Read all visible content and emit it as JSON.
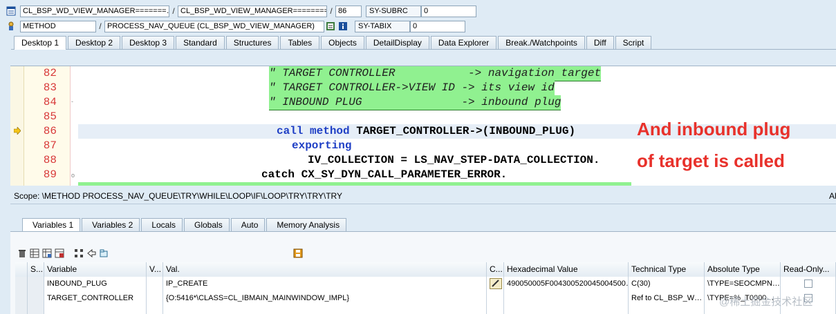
{
  "header": {
    "row1": {
      "class_field": "CL_BSP_WD_VIEW_MANAGER=======…",
      "include_field": "CL_BSP_WD_VIEW_MANAGER========…",
      "line_field": "86",
      "sysvar_label": "SY-SUBRC",
      "sysvar_value": "0"
    },
    "row2": {
      "type_field": "METHOD",
      "method_field": "PROCESS_NAV_QUEUE (CL_BSP_WD_VIEW_MANAGER)",
      "sysvar_label": "SY-TABIX",
      "sysvar_value": "0"
    },
    "separator": "/"
  },
  "tabs": [
    "Desktop 1",
    "Desktop 2",
    "Desktop 3",
    "Standard",
    "Structures",
    "Tables",
    "Objects",
    "DetailDisplay",
    "Data Explorer",
    "Break./Watchpoints",
    "Diff",
    "Script"
  ],
  "code": {
    "lines": [
      {
        "num": "82",
        "text": "\" TARGET CONTROLLER           -> navigation target"
      },
      {
        "num": "83",
        "text": "\" TARGET CONTROLLER->VIEW ID -> its view id"
      },
      {
        "num": "84",
        "text": "\" INBOUND PLUG               -> inbound plug"
      },
      {
        "num": "85",
        "text": ""
      },
      {
        "num": "86",
        "kw1": "call method",
        "rest": " TARGET_CONTROLLER->(INBOUND_PLUG)"
      },
      {
        "num": "87",
        "kw1": "exporting"
      },
      {
        "num": "88",
        "text": "IV_COLLECTION = LS_NAV_STEP-DATA_COLLECTION."
      },
      {
        "num": "89",
        "kw1": "catch",
        "rest": " CX_SY_DYN_CALL_PARAMETER_ERROR."
      }
    ],
    "annotation_line1": "And inbound plug",
    "annotation_line2": "of target is called"
  },
  "scope": {
    "text": "Scope: \\METHOD PROCESS_NAV_QUEUE\\TRY\\WHILE\\LOOP\\IF\\LOOP\\TRY\\TRY\\TRY",
    "right": "Al"
  },
  "bottom_tabs": [
    "Variables 1",
    "Variables 2",
    "Locals",
    "Globals",
    "Auto",
    "Memory Analysis"
  ],
  "table": {
    "headers": [
      "S...",
      "Variable",
      "V...",
      "Val.",
      "C...",
      "Hexadecimal Value",
      "Technical Type",
      "Absolute Type",
      "Read-Only..."
    ],
    "rows": [
      {
        "variable": "INBOUND_PLUG",
        "value": "IP_CREATE",
        "hex": "490050005F004300520045004500…",
        "tech": "C(30)",
        "abs": "\\TYPE=SEOCMPN…"
      },
      {
        "variable": "TARGET_CONTROLLER",
        "value": "{O:5416*\\CLASS=CL_IBMAIN_MAINWINDOW_IMPL}",
        "hex": "",
        "tech": "Ref to CL_BSP_W…",
        "abs": "\\TYPE=%_T0000…"
      }
    ]
  },
  "watermark": "@稀土掘金技术社区"
}
